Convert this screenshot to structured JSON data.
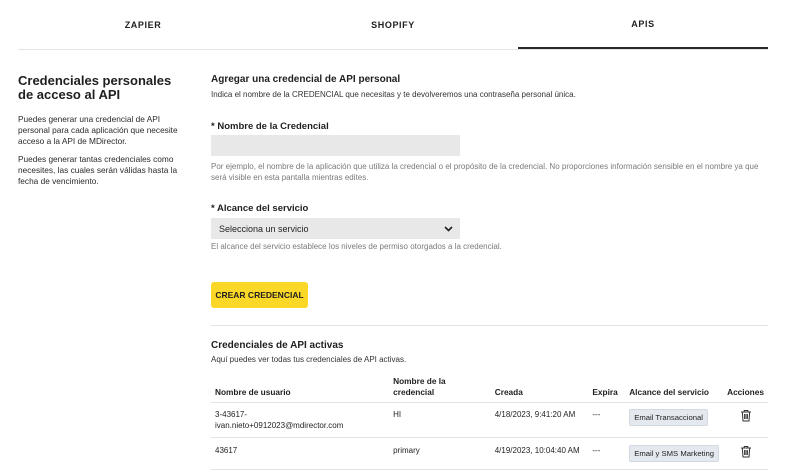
{
  "tabs": [
    {
      "label": "ZAPIER",
      "active": false
    },
    {
      "label": "SHOPIFY",
      "active": false
    },
    {
      "label": "APIS",
      "active": true
    }
  ],
  "left": {
    "title": "Credenciales personales de acceso al API",
    "paragraphs": [
      "Puedes generar una credencial de API personal para cada aplicación que necesite acceso a la API de MDirector.",
      "Puedes generar tantas credenciales como necesites, las cuales serán válidas hasta la fecha de vencimiento."
    ]
  },
  "form": {
    "title": "Agregar una credencial de API personal",
    "subtitle": "Indica el nombre de la CREDENCIAL que necesitas y te devolveremos una contraseña personal única.",
    "name_label": "* Nombre de la Credencial",
    "name_value": "",
    "name_help": "Por ejemplo, el nombre de la aplicación que utiliza la credencial o el propósito de la credencial. No proporciones información sensible en el nombre ya que será visible en esta pantalla mientras edites.",
    "scope_label": "* Alcance del servicio",
    "scope_selected": "Selecciona un servicio",
    "scope_help": "El alcance del servicio establece los niveles de permiso otorgados a la credencial.",
    "submit_label": "CREAR CREDENCIAL"
  },
  "active": {
    "title": "Credenciales de API activas",
    "subtitle": "Aquí puedes ver todas tus credenciales de API activas.",
    "columns": [
      "Nombre de usuario",
      "Nombre de la credencial",
      "Creada",
      "Expira",
      "Alcance del servicio",
      "Acciones"
    ],
    "rows": [
      {
        "user_line1": "3-43617-",
        "user_line2": "ivan.nieto+0912023@mdirector.com",
        "credential": "HI",
        "created": "4/18/2023, 9:41:20 AM",
        "expires": "---",
        "scope": "Email Transaccional"
      },
      {
        "user_line1": "43617",
        "user_line2": "",
        "credential": "primary",
        "created": "4/19/2023, 10:04:40 AM",
        "expires": "---",
        "scope": "Email y SMS Marketing"
      }
    ]
  },
  "icons": {
    "trash": "trash-icon",
    "chevron": "chevron-down-icon"
  }
}
